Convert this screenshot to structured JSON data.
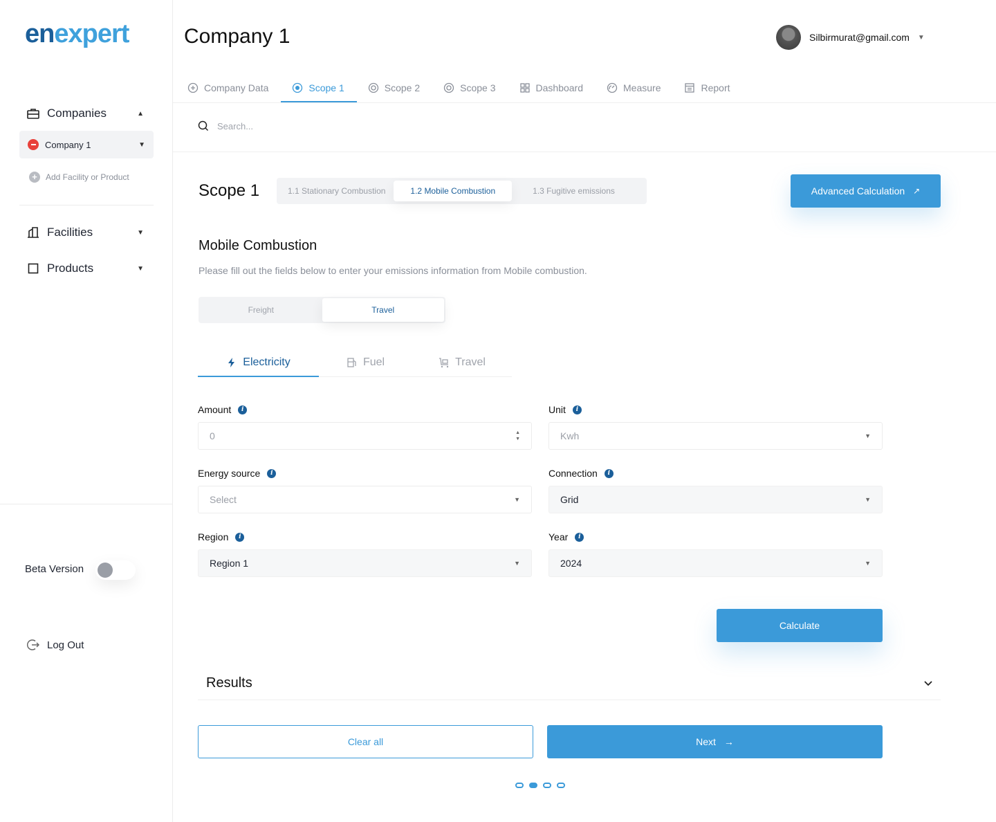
{
  "brand": {
    "part1": "en",
    "part2": "expert"
  },
  "sidebar": {
    "companies_label": "Companies",
    "company_item": "Company 1",
    "add_facility": "Add Facility or Product",
    "facilities_label": "Facilities",
    "products_label": "Products",
    "beta_label": "Beta Version",
    "logout_label": "Log Out"
  },
  "header": {
    "title": "Company 1",
    "user_email": "Silbirmurat@gmail.com"
  },
  "nav": {
    "tabs": [
      {
        "label": "Company Data",
        "icon": "plus-circle-icon"
      },
      {
        "label": "Scope 1",
        "icon": "target-icon",
        "active": true
      },
      {
        "label": "Scope 2",
        "icon": "target-icon"
      },
      {
        "label": "Scope 3",
        "icon": "target-icon"
      },
      {
        "label": "Dashboard",
        "icon": "grid-icon"
      },
      {
        "label": "Measure",
        "icon": "gauge-icon"
      },
      {
        "label": "Report",
        "icon": "report-icon"
      }
    ]
  },
  "search": {
    "placeholder": "Search..."
  },
  "scope": {
    "title": "Scope 1",
    "tabs": [
      "1.1 Stationary Combustion",
      "1.2 Mobile Combustion",
      "1.3 Fugitive emissions"
    ],
    "active_tab": 1,
    "advanced_button": "Advanced Calculation"
  },
  "section": {
    "title": "Mobile Combustion",
    "description": "Please fill out the fields below to enter your emissions information from Mobile combustion."
  },
  "segment": {
    "options": [
      "Freight",
      "Travel"
    ],
    "active": 1
  },
  "sub_tabs": {
    "items": [
      "Electricity",
      "Fuel",
      "Travel"
    ],
    "active": 0
  },
  "form": {
    "amount_label": "Amount",
    "amount_value": "0",
    "unit_label": "Unit",
    "unit_value": "Kwh",
    "energy_label": "Energy source",
    "energy_value": "Select",
    "connection_label": "Connection",
    "connection_value": "Grid",
    "region_label": "Region",
    "region_value": "Region 1",
    "year_label": "Year",
    "year_value": "2024",
    "calculate_button": "Calculate"
  },
  "results": {
    "label": "Results"
  },
  "actions": {
    "clear": "Clear all",
    "next": "Next"
  },
  "pager": {
    "count": 4,
    "active": 1
  },
  "colors": {
    "primary": "#3b9ad9",
    "dark_blue": "#1b5f9a",
    "danger": "#e8413b"
  }
}
